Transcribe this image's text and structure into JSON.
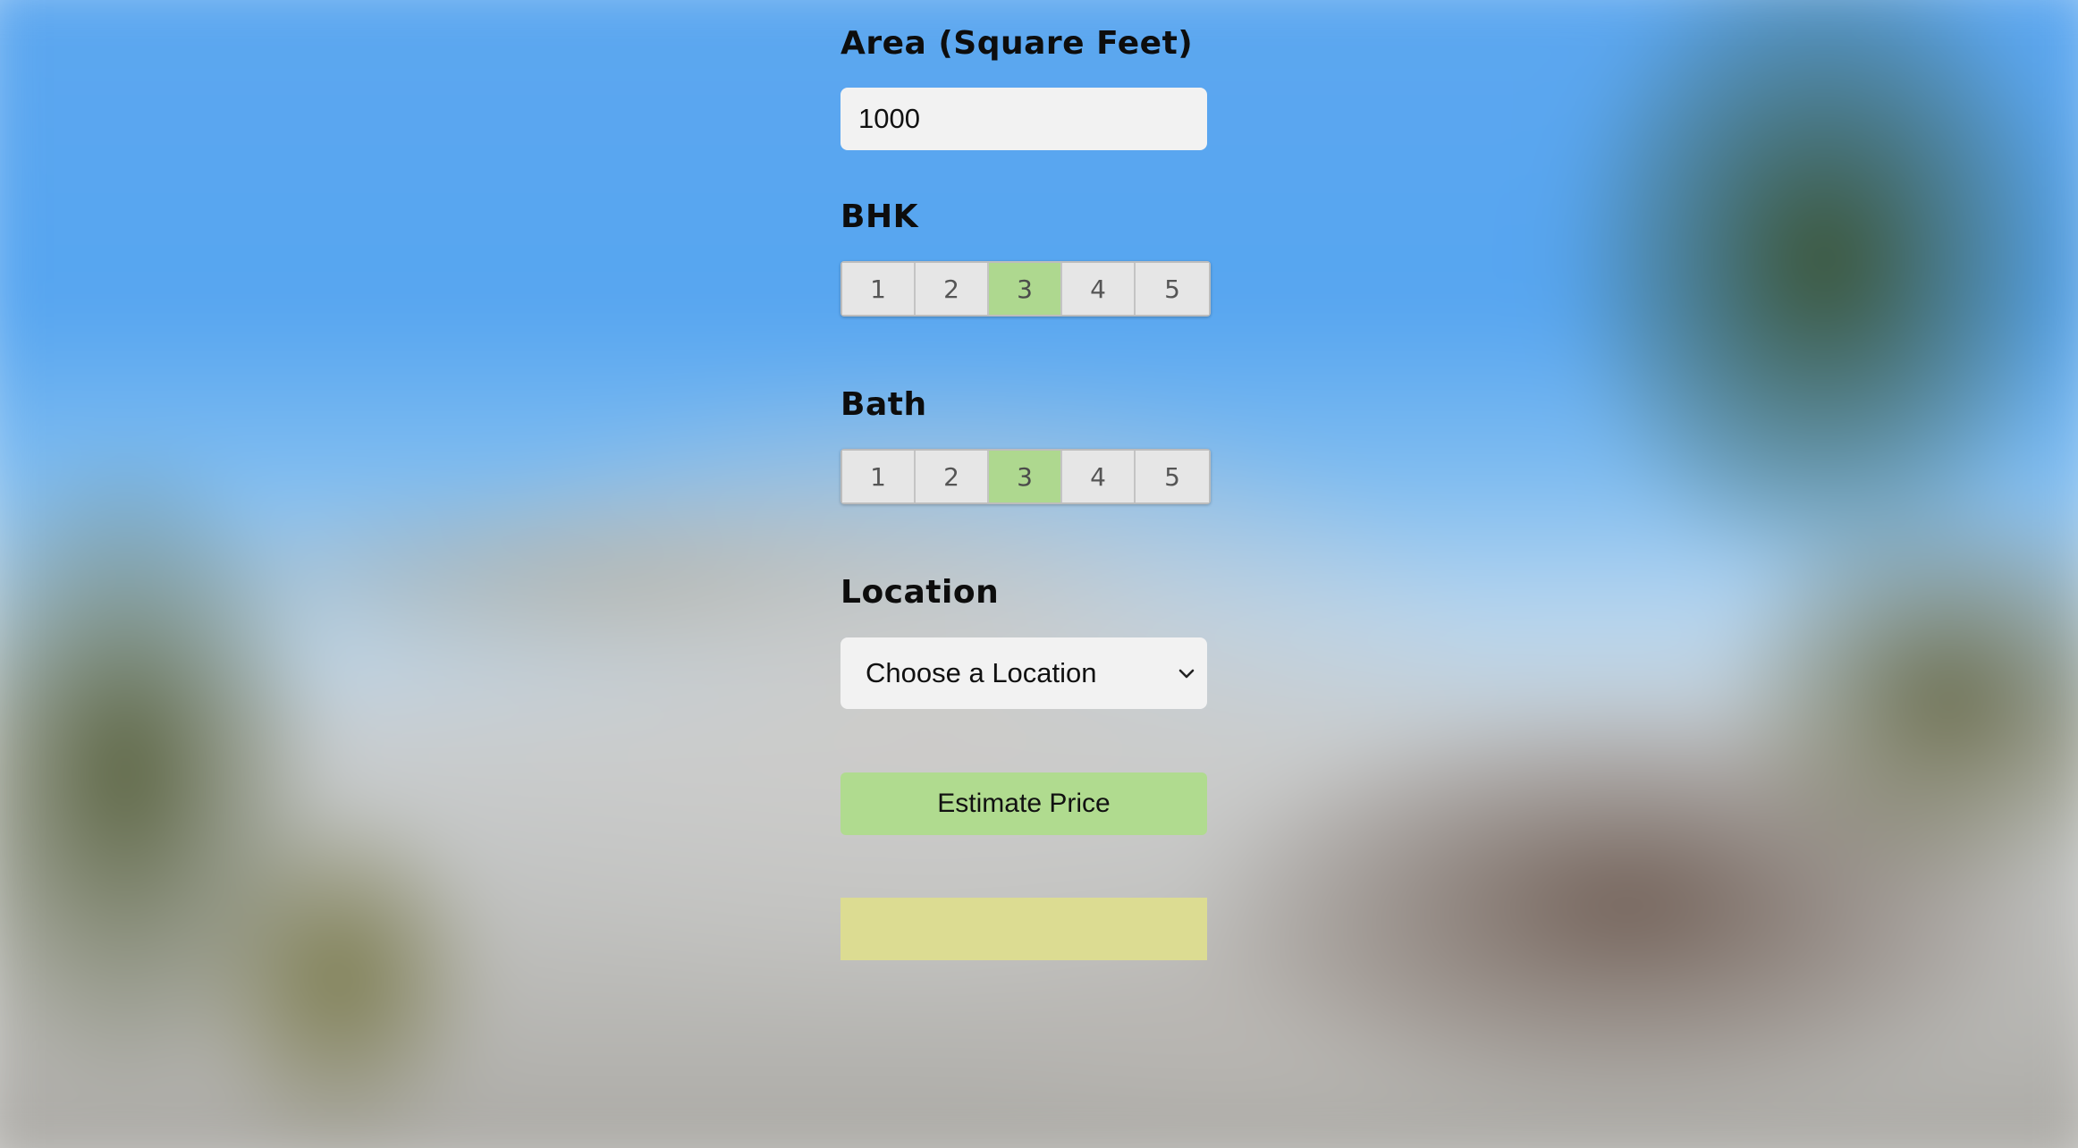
{
  "form": {
    "area": {
      "label": "Area (Square Feet)",
      "value": "1000"
    },
    "bhk": {
      "label": "BHK",
      "options": [
        "1",
        "2",
        "3",
        "4",
        "5"
      ],
      "selected": "3"
    },
    "bath": {
      "label": "Bath",
      "options": [
        "1",
        "2",
        "3",
        "4",
        "5"
      ],
      "selected": "3"
    },
    "location": {
      "label": "Location",
      "selected": "Choose a Location"
    },
    "estimate_button": "Estimate Price",
    "result": ""
  },
  "colors": {
    "selected_option": "#aed88f",
    "button": "#b0db8f",
    "result_box": "#dcdc92",
    "input_bg": "#f2f2f2"
  },
  "icons": {
    "select_arrow": "chevron-down-icon"
  }
}
